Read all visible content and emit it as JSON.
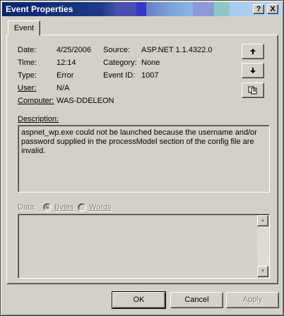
{
  "window": {
    "title": "Event Properties"
  },
  "titlebar_buttons": {
    "help": "?",
    "close": "X"
  },
  "tab": {
    "label": "Event"
  },
  "fields": {
    "date_label": "Date:",
    "date_value": "4/25/2006",
    "time_label": "Time:",
    "time_value": "12:14",
    "type_label": "Type:",
    "type_value": "Error",
    "user_label": "User:",
    "user_value": "N/A",
    "computer_label": "Computer:",
    "computer_value": "WAS-DDELEON",
    "source_label": "Source:",
    "source_value": "ASP.NET 1.1.4322.0",
    "category_label": "Category:",
    "category_value": "None",
    "eventid_label": "Event ID:",
    "eventid_value": "1007"
  },
  "description": {
    "label": "Description:",
    "text": "aspnet_wp.exe could not be launched because the username and/or password supplied in the processModel section of the config file are invalid."
  },
  "data_section": {
    "label": "Data:",
    "bytes": "Bytes",
    "words": "Words",
    "selected": "Bytes"
  },
  "buttons": {
    "ok": "OK",
    "cancel": "Cancel",
    "apply": "Apply"
  },
  "icons": {
    "prev": "arrow-up-icon",
    "next": "arrow-down-icon",
    "copy": "copy-icon"
  }
}
